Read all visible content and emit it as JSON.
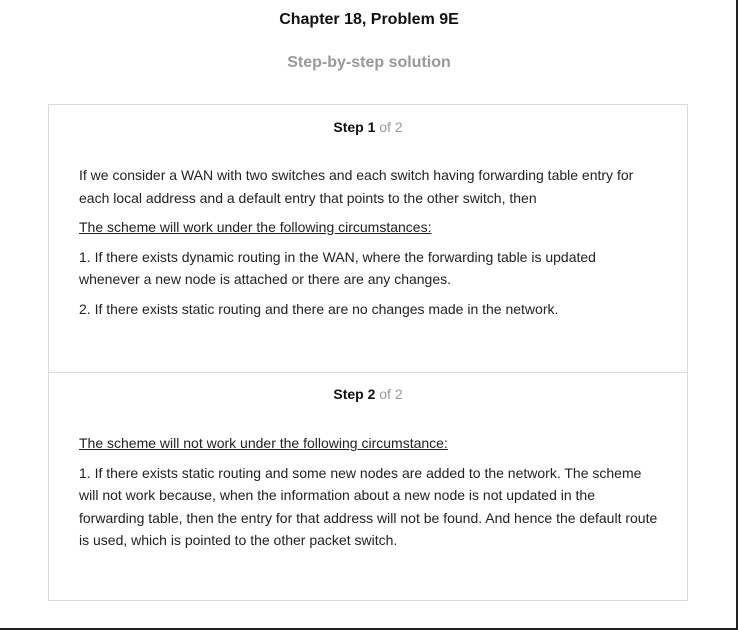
{
  "header": {
    "chapter_title": "Chapter 18, Problem 9E",
    "subtitle": "Step-by-step solution"
  },
  "steps": [
    {
      "label": "Step 1",
      "of": "of 2",
      "paragraphs": [
        "If we consider a WAN with two switches and each switch having forwarding table entry for each local address and a default entry that points to the other switch, then",
        "The scheme will work under the following circumstances:",
        "1. If there exists dynamic routing in the WAN, where the forwarding table is updated whenever a new node is attached or there are any changes.",
        "2. If there exists static routing and there are no changes made in the network."
      ]
    },
    {
      "label": "Step 2",
      "of": "of 2",
      "paragraphs": [
        "The scheme will not work under the following circumstance:",
        "1. If there exists static routing and some new nodes are added to the network. The scheme will not work because, when the information about a new node is not updated in the forwarding table, then the entry for that address will not be found. And hence the default route is used, which is pointed to the other packet switch."
      ]
    }
  ]
}
